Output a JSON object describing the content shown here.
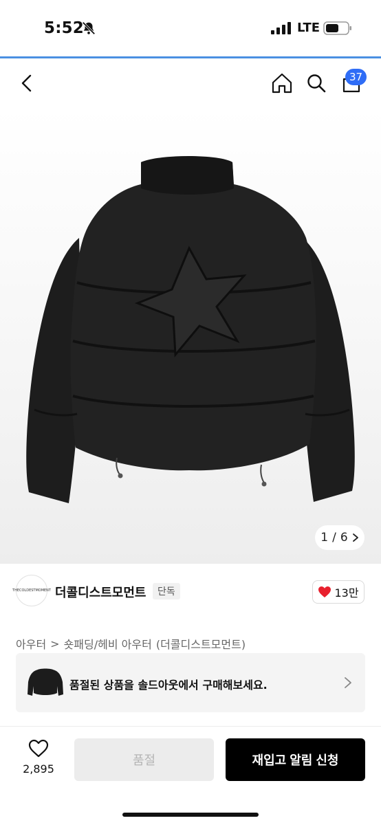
{
  "status": {
    "time": "5:52",
    "network": "LTE"
  },
  "nav": {
    "cart_count": "37"
  },
  "gallery": {
    "current": "1",
    "separator": "/",
    "total": "6"
  },
  "brand": {
    "logo_text": "THECOLDESTMOMENT",
    "name": "더콜디스트모먼트",
    "exclusive_label": "단독",
    "likes": "13만"
  },
  "breadcrumb": {
    "category": "아우터",
    "separator": ">",
    "subcategory": "숏패딩/헤비 아우터",
    "brand": "(더콜디스트모먼트)"
  },
  "soldout_banner": {
    "text": "품절된 상품을 솔드아웃에서 구매해보세요."
  },
  "bottom": {
    "wish_count": "2,895",
    "soldout_label": "품절",
    "restock_label": "재입고 알림 신청"
  },
  "colors": {
    "accent_blue": "#2f6df6",
    "heart_red": "#e8202d",
    "primary_button": "#000000"
  }
}
